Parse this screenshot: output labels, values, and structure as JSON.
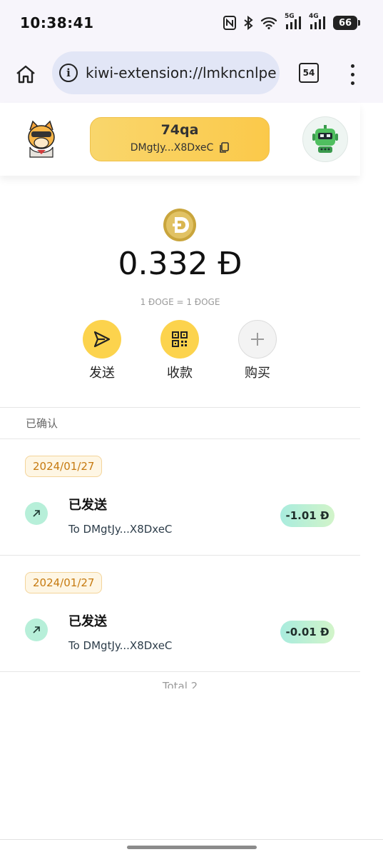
{
  "status_bar": {
    "time": "10:38:41",
    "battery": "66",
    "network_1": "5G",
    "network_2": "4G",
    "icons": [
      "nfc-icon",
      "bluetooth-icon",
      "wifi-icon",
      "signal-icon",
      "battery-icon"
    ]
  },
  "browser": {
    "url": "kiwi-extension://lmkncnlpe",
    "tab_count": "54"
  },
  "wallet": {
    "account_name": "74qa",
    "address": "DMgtJy...X8DxeC"
  },
  "balance": {
    "amount": "0.332 Ð",
    "rate": "1 ÐOGE = 1 ÐOGE"
  },
  "actions": {
    "send": "发送",
    "receive": "收款",
    "buy": "购买"
  },
  "section_label": "已确认",
  "transactions": [
    {
      "date": "2024/01/27",
      "title": "已发送",
      "to": "To DMgtJy...X8DxeC",
      "amount": "-1.01 Ð"
    },
    {
      "date": "2024/01/27",
      "title": "已发送",
      "to": "To DMgtJy...X8DxeC",
      "amount": "-0.01 Ð"
    }
  ],
  "total": "Total 2",
  "colors": {
    "accent": "#fcd34d",
    "amount_badge": "#a9ecde",
    "date_badge_text": "#c67a10"
  }
}
